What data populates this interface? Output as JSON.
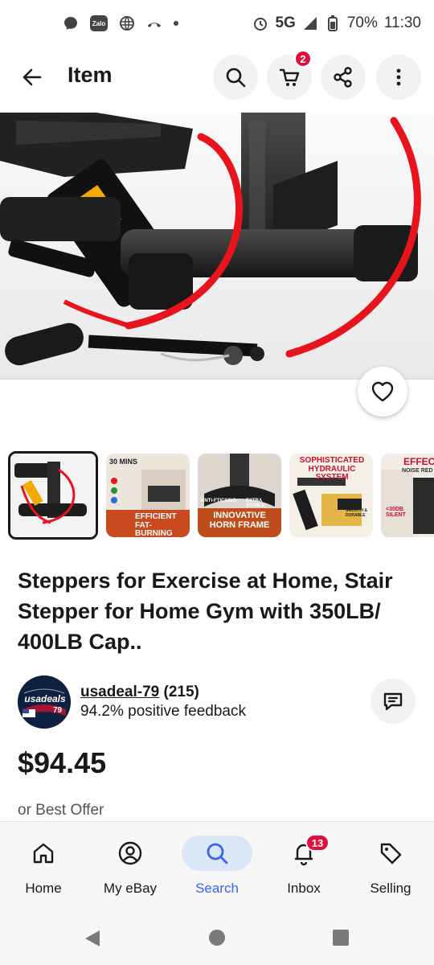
{
  "status_bar": {
    "zalo_label": "Zalo",
    "network": "5G",
    "battery": "70%",
    "time": "11:30"
  },
  "header": {
    "title": "Item",
    "cart_count": "2"
  },
  "thumbnails": [
    {
      "caption": ""
    },
    {
      "caption_top": "30 MINS",
      "caption_bottom": "EFFICIENT FAT-BURNING"
    },
    {
      "caption_top": "ANTI-FTICSING",
      "caption_mid": "EXTRA STABLE",
      "caption_bottom": "INNOVATIVE HORN FRAME"
    },
    {
      "caption_top": "SOPHISTICATED HYDRAULIC SYSTEM",
      "caption_bottom": "QUIET, SMOOTH & DURABLE"
    },
    {
      "caption_top": "EFFEC",
      "caption_mid": "NOISE RED",
      "caption_bottom": "<30DB SILENT"
    }
  ],
  "item": {
    "title": "Steppers for Exercise at Home, Stair Stepper for Home Gym with 350LB/ 400LB Cap..",
    "price": "$94.45",
    "best_offer": "or Best Offer"
  },
  "seller": {
    "name": "usadeal-79",
    "count": "(215)",
    "feedback": "94.2% positive feedback",
    "avatar_text": "usadeals",
    "avatar_sub": "79"
  },
  "bottom_nav": [
    {
      "label": "Home",
      "icon": "home-icon"
    },
    {
      "label": "My eBay",
      "icon": "person-icon"
    },
    {
      "label": "Search",
      "icon": "search-icon"
    },
    {
      "label": "Inbox",
      "icon": "bell-icon",
      "badge": "13"
    },
    {
      "label": "Selling",
      "icon": "tag-icon"
    }
  ],
  "colors": {
    "accent": "#3665f3",
    "badge": "#e0103a",
    "band": "#e8141d"
  }
}
